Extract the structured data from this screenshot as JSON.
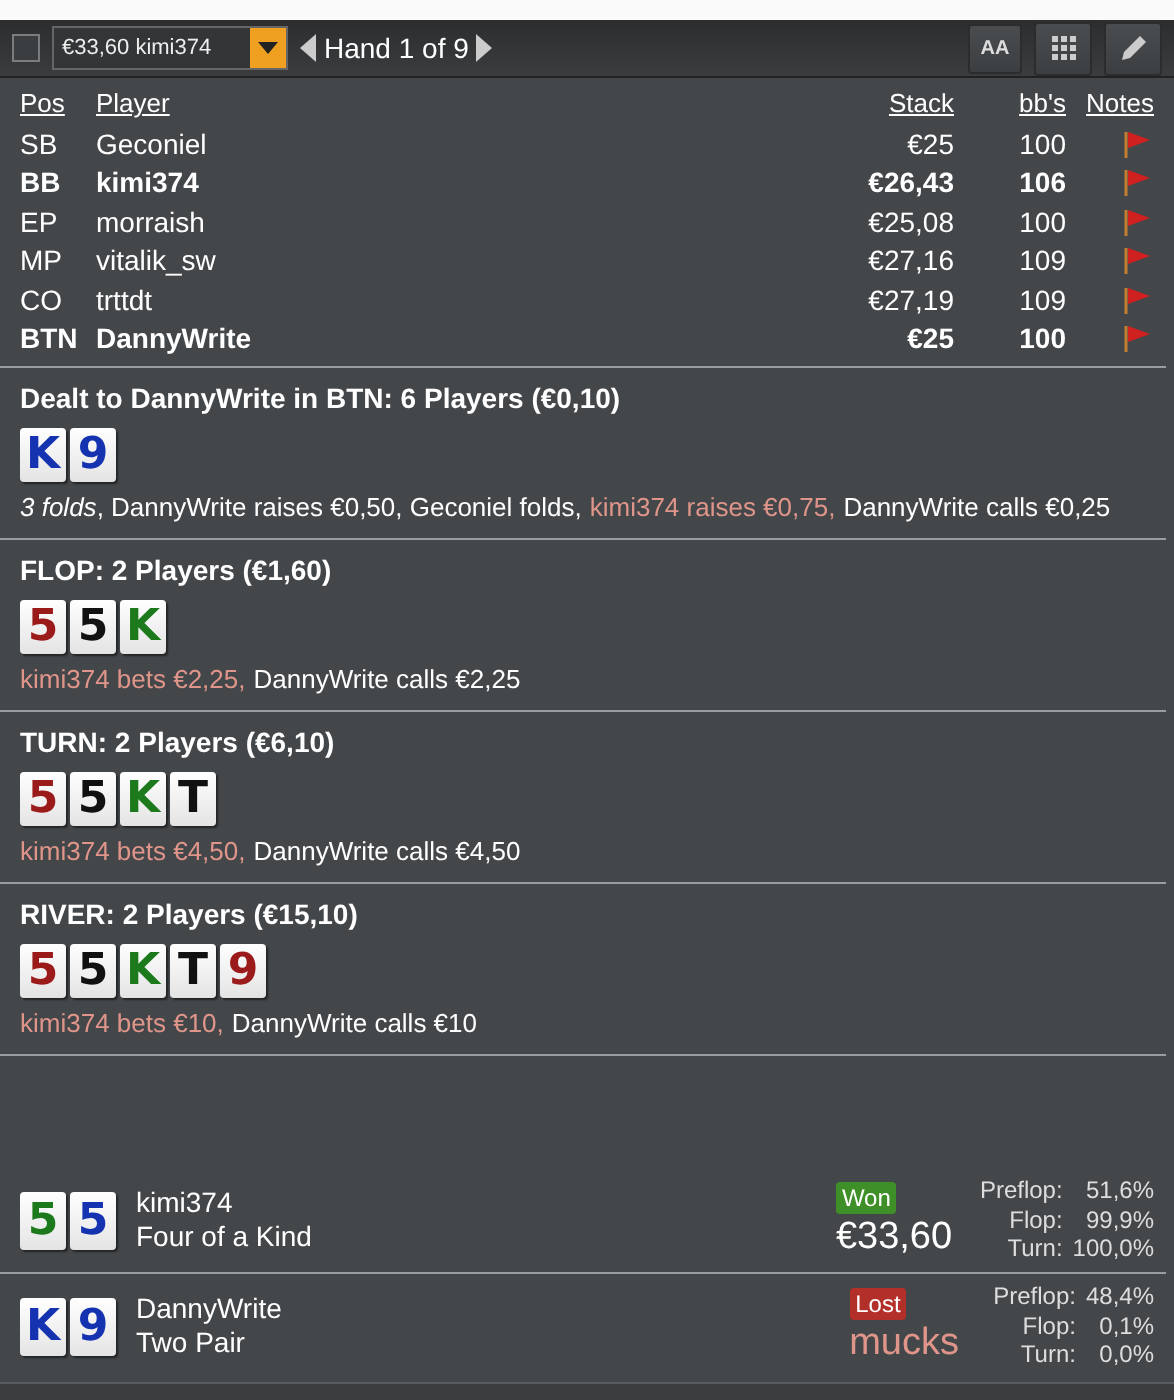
{
  "toolbar": {
    "checkbox": {
      "checked": false
    },
    "hand_select": {
      "value": "€33,60 kimi374"
    },
    "hand_label": "Hand 1 of 9",
    "font_button": "AA"
  },
  "players": {
    "columns": [
      "Pos",
      "Player",
      "Stack",
      "bb's",
      "Notes"
    ],
    "rows": [
      {
        "pos": "SB",
        "player": "Geconiel",
        "stack": "€25",
        "bbs": "100",
        "bold": false
      },
      {
        "pos": "BB",
        "player": "kimi374",
        "stack": "€26,43",
        "bbs": "106",
        "bold": true
      },
      {
        "pos": "EP",
        "player": "morraish",
        "stack": "€25,08",
        "bbs": "100",
        "bold": false
      },
      {
        "pos": "MP",
        "player": "vitalik_sw",
        "stack": "€27,16",
        "bbs": "109",
        "bold": false
      },
      {
        "pos": "CO",
        "player": "trttdt",
        "stack": "€27,19",
        "bbs": "109",
        "bold": false
      },
      {
        "pos": "BTN",
        "player": "DannyWrite",
        "stack": "€25",
        "bbs": "100",
        "bold": true
      }
    ]
  },
  "streets": [
    {
      "title": "Dealt to DannyWrite in BTN: 6 Players (€0,10)",
      "cards": [
        {
          "rank": "K",
          "color": "#1533b0"
        },
        {
          "rank": "9",
          "color": "#1533b0"
        }
      ],
      "actions": [
        {
          "text": "*3 folds*, DannyWrite raises €0,50, Geconiel folds,",
          "kind": "normal"
        },
        {
          "text": "kimi374 raises €0,75,",
          "kind": "villain"
        },
        {
          "text": "DannyWrite calls €0,25",
          "kind": "normal"
        }
      ]
    },
    {
      "title": "FLOP: 2 Players (€1,60)",
      "cards": [
        {
          "rank": "5",
          "color": "#9b1b1b"
        },
        {
          "rank": "5",
          "color": "#111111"
        },
        {
          "rank": "K",
          "color": "#1c7a1c"
        }
      ],
      "actions": [
        {
          "text": "kimi374 bets €2,25,",
          "kind": "villain"
        },
        {
          "text": "DannyWrite calls €2,25",
          "kind": "normal"
        }
      ]
    },
    {
      "title": "TURN: 2 Players (€6,10)",
      "cards": [
        {
          "rank": "5",
          "color": "#9b1b1b"
        },
        {
          "rank": "5",
          "color": "#111111"
        },
        {
          "rank": "K",
          "color": "#1c7a1c"
        },
        {
          "rank": "T",
          "color": "#111111"
        }
      ],
      "actions": [
        {
          "text": "kimi374 bets €4,50,",
          "kind": "villain"
        },
        {
          "text": "DannyWrite calls €4,50",
          "kind": "normal"
        }
      ]
    },
    {
      "title": "RIVER: 2 Players (€15,10)",
      "cards": [
        {
          "rank": "5",
          "color": "#9b1b1b"
        },
        {
          "rank": "5",
          "color": "#111111"
        },
        {
          "rank": "K",
          "color": "#1c7a1c"
        },
        {
          "rank": "T",
          "color": "#111111"
        },
        {
          "rank": "9",
          "color": "#9b1b1b"
        }
      ],
      "actions": [
        {
          "text": "kimi374 bets €10,",
          "kind": "villain"
        },
        {
          "text": "DannyWrite calls €10",
          "kind": "normal"
        }
      ]
    }
  ],
  "results": [
    {
      "cards": [
        {
          "rank": "5",
          "color": "#1c7a1c"
        },
        {
          "rank": "5",
          "color": "#1533b0"
        }
      ],
      "player": "kimi374",
      "hand": "Four of a Kind",
      "kind": "won",
      "badge": "Won",
      "amount": "€33,60",
      "equity": [
        {
          "label": "Preflop:",
          "value": "51,6%"
        },
        {
          "label": "Flop:",
          "value": "99,9%"
        },
        {
          "label": "Turn:",
          "value": "100,0%"
        }
      ]
    },
    {
      "cards": [
        {
          "rank": "K",
          "color": "#1533b0"
        },
        {
          "rank": "9",
          "color": "#1533b0"
        }
      ],
      "player": "DannyWrite",
      "hand": "Two Pair",
      "kind": "lost",
      "badge": "Lost",
      "amount": "mucks",
      "equity": [
        {
          "label": "Preflop:",
          "value": "48,4%"
        },
        {
          "label": "Flop:",
          "value": "0,1%"
        },
        {
          "label": "Turn:",
          "value": "0,0%"
        }
      ]
    }
  ]
}
